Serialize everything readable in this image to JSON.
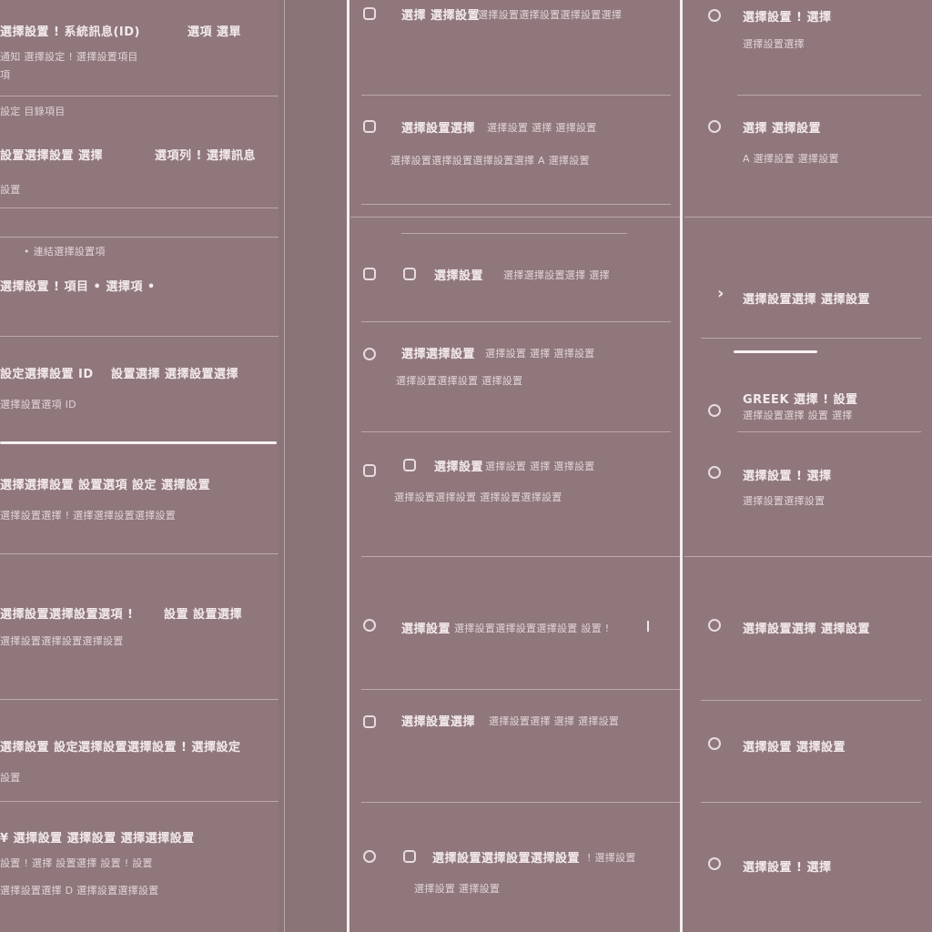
{
  "col1": {
    "rows": [
      {
        "title": "選擇設置 ! 系統訊息(ID)",
        "extra": "選項 選單",
        "sub": "通知 選擇設定 ! 選擇設置項目",
        "note": "項"
      },
      {
        "title": "設定 目錄項目",
        "extra": "",
        "sub": "",
        "note": ""
      },
      {
        "title": "設置選擇設置 選擇",
        "extra": "選項列 ! 選擇訊息",
        "sub": "設置",
        "note": ""
      },
      {
        "title": "• 連結選擇設置項",
        "extra": "",
        "sub": "",
        "note": ""
      },
      {
        "title": "選擇設置 ! 項目 • 選擇項 •",
        "extra": "",
        "sub": "",
        "note": ""
      },
      {
        "title": "設定選擇設置 ID",
        "extra": "設置選擇 選擇設置選擇",
        "sub": "選擇設置選項 ID",
        "note": ""
      },
      {
        "title": "選擇選擇設置 設置選項 設定 選擇設置",
        "extra": "",
        "sub": "選擇設置選擇 ! 選擇選擇設置選擇設置",
        "note": ""
      },
      {
        "title": "選擇設置選擇設置選項 !",
        "extra": "設置 設置選擇",
        "sub": "選擇設置選擇設置選擇設置",
        "note": ""
      },
      {
        "title": "選擇設置 設定選擇設置選擇設置 ! 選擇設定",
        "extra": "",
        "sub": "設置",
        "note": ""
      },
      {
        "title": "¥ 選擇設置 選擇設置 選擇選擇設置",
        "extra": "",
        "sub": "設置 ! 選擇 設置選擇 設置 ! 設置",
        "note": "選擇設置選擇 D 選擇設置選擇設置"
      }
    ]
  },
  "col2": {
    "rows": [
      {
        "title": "選擇 選擇設置",
        "extra": "選擇設置選擇設置選擇設置選擇",
        "sub": ""
      },
      {
        "title": "選擇設置選擇",
        "extra": "選擇設置 選擇 選擇設置",
        "sub": "選擇設置選擇設置選擇設置選擇 A 選擇設置"
      },
      {
        "title": "選擇設置",
        "extra": "選擇選擇設置選擇 選擇",
        "sub": ""
      },
      {
        "title": "選擇選擇設置",
        "extra": "選擇設置 選擇 選擇設置",
        "sub": "選擇設置選擇設置 選擇設置"
      },
      {
        "title": "選擇設置",
        "extra": "選擇設置 選擇 選擇設置",
        "sub": "選擇設置選擇設置 選擇設置選擇設置"
      },
      {
        "title": "選擇設置",
        "extra": "選擇設置選擇設置選擇設置 設置 !",
        "sub": ""
      },
      {
        "title": "選擇設置選擇",
        "extra": "選擇設置選擇 選擇 選擇設置",
        "sub": ""
      },
      {
        "title": "選擇設置選擇設置選擇設置",
        "extra": "! 選擇設置",
        "sub": "選擇設置 選擇設置"
      }
    ]
  },
  "col3": {
    "rows": [
      {
        "title": "選擇設置 ! 選擇",
        "sub": "選擇設置選擇"
      },
      {
        "title": "選擇 選擇設置",
        "sub": "A 選擇設置 選擇設置"
      },
      {
        "title": "選擇設置選擇 選擇設置",
        "sub": ""
      },
      {
        "title": "GREEK 選擇 ! 設置",
        "sub": "選擇設置選擇 設置 選擇"
      },
      {
        "title": "選擇設置 ! 選擇",
        "sub": "選擇設置選擇設置"
      },
      {
        "title": "選擇設置選擇 選擇設置",
        "sub": ""
      },
      {
        "title": "選擇設置 選擇設置",
        "sub": ""
      },
      {
        "title": "選擇設置 ! 選擇",
        "sub": ""
      }
    ]
  },
  "colors": {
    "background": "#8f777b",
    "divider": "#bda8ac",
    "text": "#f3eaec"
  }
}
